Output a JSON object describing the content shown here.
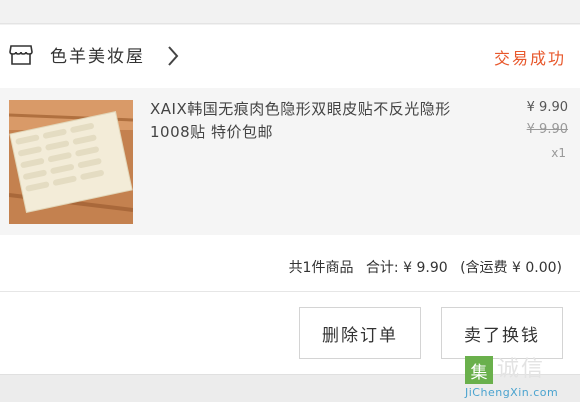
{
  "store": {
    "icon": "store-icon",
    "name": "色羊美妆屋",
    "chevron_icon": "chevron-right-icon",
    "status": "交易成功"
  },
  "item": {
    "title": "XAIX韩国无痕肉色隐形双眼皮贴不反光隐形 1008贴 特价包邮",
    "price": "¥ 9.90",
    "original_price": "¥ 9.90",
    "quantity": "x1"
  },
  "summary": {
    "count": "共1件商品",
    "total": "合计: ¥ 9.90",
    "shipping": "(含运费 ¥ 0.00)"
  },
  "actions": {
    "delete_label": "删除订单",
    "resell_label": "卖了换钱"
  },
  "watermark": {
    "box_char": "集",
    "text": "诚信",
    "url": "JiChengXin.com"
  },
  "colors": {
    "status": "#e8582c",
    "watermark_green": "#6ab04c",
    "watermark_url": "#4aa3cf"
  }
}
